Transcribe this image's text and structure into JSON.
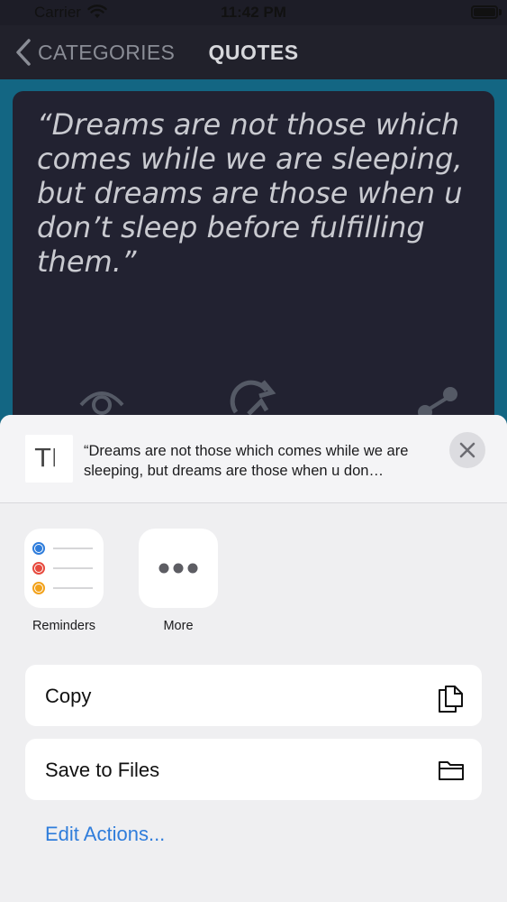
{
  "status_bar": {
    "carrier": "Carrier",
    "time": "11:42 PM"
  },
  "nav": {
    "back_label": "CATEGORIES",
    "title": "QUOTES"
  },
  "quote": {
    "text": "“Dreams are not those which comes while we are sleeping, but dreams are those when u don’t sleep before fulfilling them.”"
  },
  "card_icons": [
    "eye-icon",
    "refresh-icon",
    "share-icon"
  ],
  "share_sheet": {
    "thumbnail_glyph": "T",
    "preview_text": "“Dreams are not those which comes while we are sleeping, but dreams are those when u don…",
    "apps": [
      {
        "label": "Reminders",
        "icon": "reminders-icon"
      },
      {
        "label": "More",
        "icon": "more-icon"
      }
    ],
    "actions": [
      {
        "label": "Copy",
        "icon": "copy-icon"
      },
      {
        "label": "Save to Files",
        "icon": "folder-icon"
      }
    ],
    "edit_actions_label": "Edit Actions..."
  },
  "colors": {
    "accent": "#2f7ddb",
    "card": "#222231",
    "background": "#136683",
    "sheet": "#efeff1"
  }
}
